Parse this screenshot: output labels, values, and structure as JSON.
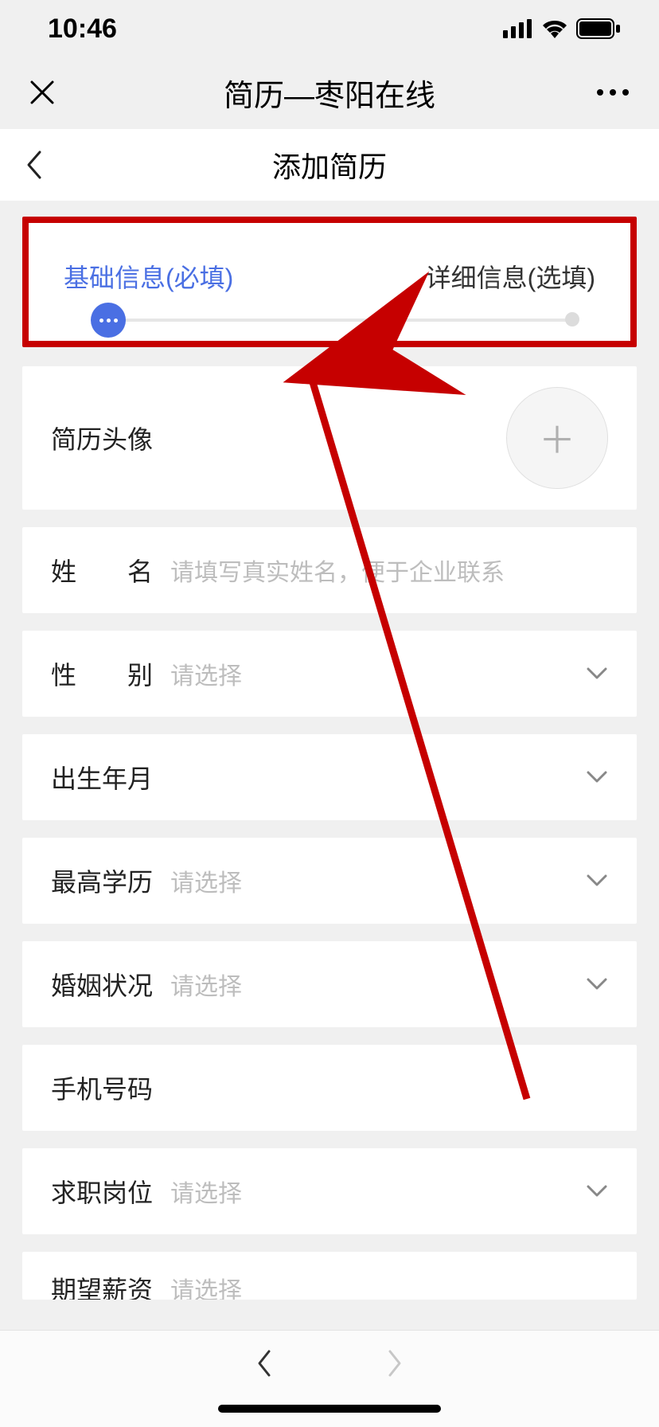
{
  "status": {
    "time": "10:46"
  },
  "nav": {
    "title": "简历—枣阳在线"
  },
  "sub": {
    "title": "添加简历"
  },
  "steps": {
    "active": "基础信息(必填)",
    "inactive": "详细信息(选填)"
  },
  "fields": {
    "avatar": {
      "label": "简历头像"
    },
    "name": {
      "label": "姓　　名",
      "placeholder": "请填写真实姓名，便于企业联系"
    },
    "gender": {
      "label": "性　　别",
      "placeholder": "请选择"
    },
    "birth": {
      "label": "出生年月"
    },
    "edu": {
      "label": "最高学历",
      "placeholder": "请选择"
    },
    "marriage": {
      "label": "婚姻状况",
      "placeholder": "请选择"
    },
    "phone": {
      "label": "手机号码"
    },
    "job": {
      "label": "求职岗位",
      "placeholder": "请选择"
    },
    "salary": {
      "label": "期望薪资",
      "placeholder": "请选择"
    }
  }
}
